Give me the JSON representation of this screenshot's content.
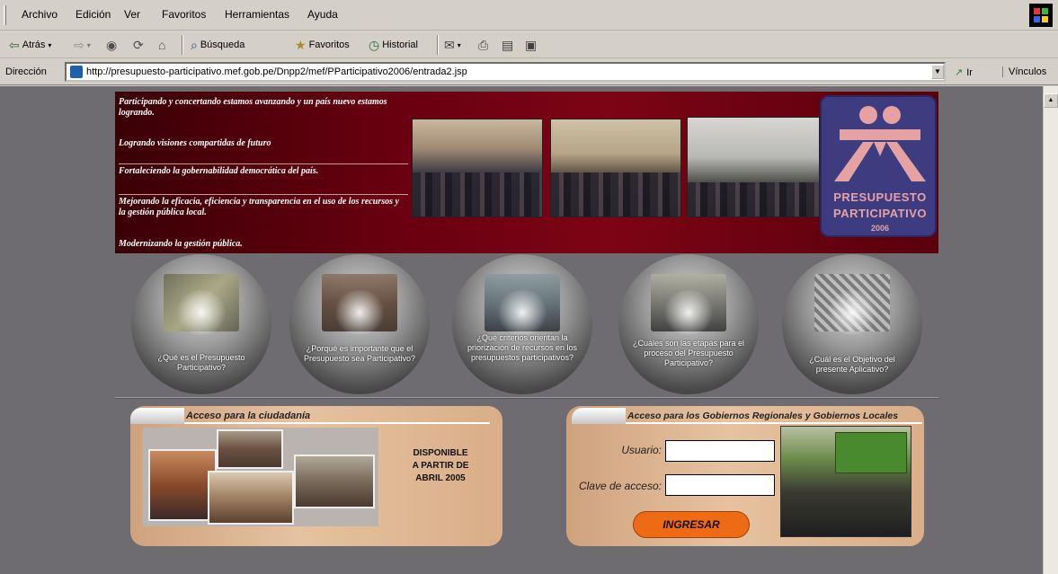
{
  "menubar": {
    "items": [
      "Archivo",
      "Edición",
      "Ver",
      "Favoritos",
      "Herramientas",
      "Ayuda"
    ]
  },
  "toolbar": {
    "back_label": "Atrás",
    "search_label": "Búsqueda",
    "favorites_label": "Favoritos",
    "history_label": "Historial"
  },
  "address": {
    "label": "Dirección",
    "url": "http://presupuesto-participativo.mef.gob.pe/Dnpp2/mef/PParticipativo2006/entrada2.jsp",
    "go_label": "Ir",
    "links_label": "Vínculos"
  },
  "banner": {
    "lines": [
      "Participando y concertando estamos avanzando y un país nuevo estamos logrando.",
      "Logrando visiones compartidas de futuro",
      "Fortaleciendo la gobernabilidad democrática del país.",
      "Mejorando la eficacia, eficiencia y transparencia en el uso de los recursos y la gestión pública local.",
      "Modernizando la gestión pública."
    ],
    "logo": {
      "line1": "PRESUPUESTO",
      "line2": "PARTICIPATIVO",
      "year": "2006"
    }
  },
  "circles": [
    "¿Qué es el Presupuesto Participativo?",
    "¿Porqué es importante que el Presupuesto sea Participativo?",
    "¿Qué criterios orientan la priorización de recursos en los presupuestos participativos?",
    "¿Cuáles son las etapas para el proceso del Presupuesto Participativo?",
    "¿Cuál es el Objetivo del presente Aplicativo?"
  ],
  "citizen_panel": {
    "title": "Acceso para la ciudadanía",
    "availability": [
      "DISPONIBLE",
      "A PARTIR DE",
      "ABRIL 2005"
    ]
  },
  "gov_panel": {
    "title": "Acceso para los Gobiernos Regionales y Gobiernos Locales",
    "user_label": "Usuario:",
    "user_value": "",
    "password_label": "Clave de acceso:",
    "password_value": "",
    "submit_label": "INGRESAR"
  },
  "colors": {
    "banner_red": "#6a0010",
    "logo_blue": "#3e3c80",
    "logo_pink": "#e6a2a2",
    "panel_tan": "#e6c2a0",
    "button_orange": "#ee6a14",
    "page_gray": "#6e6c70"
  }
}
